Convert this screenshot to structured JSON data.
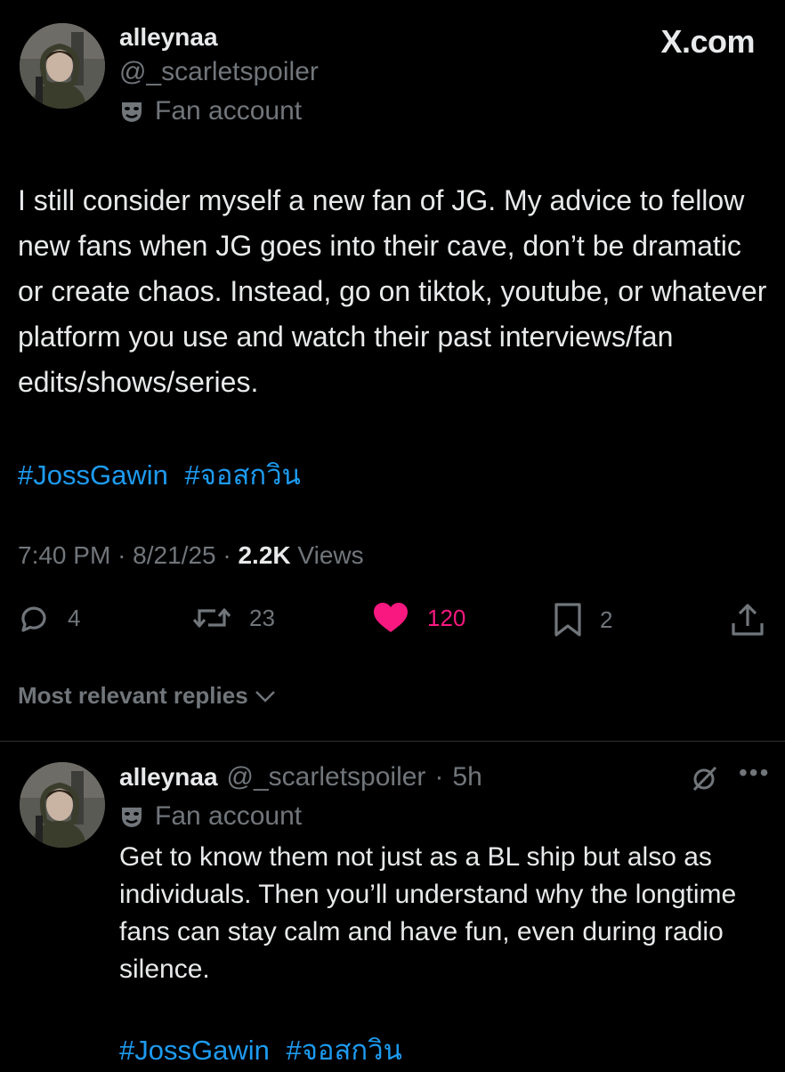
{
  "post": {
    "author": {
      "name": "alleynaa",
      "handle": "@_scarletspoiler",
      "label": "Fan account"
    },
    "site": "X.com",
    "text": "I still consider myself a new fan of JG. My advice to fellow new fans when JG goes into their cave, don’t be dramatic or create chaos. Instead, go on tiktok, youtube, or whatever platform you use and watch their past interviews/fan edits/shows/series.",
    "hashtags": [
      "#JossGawin",
      "#จอสกวิน"
    ],
    "time": "7:40 PM",
    "date": "8/21/25",
    "views_count": "2.2K",
    "views_label": "Views",
    "actions": {
      "replies": "4",
      "reposts": "23",
      "likes": "120",
      "bookmarks": "2"
    }
  },
  "replies_filter": "Most relevant replies",
  "reply": {
    "name": "alleynaa",
    "handle": "@_scarletspoiler",
    "age": "5h",
    "label": "Fan account",
    "text": "Get to know them not just as a BL ship but also as individuals. Then you’ll understand why the longtime fans can stay calm and have fun, even during radio silence.",
    "hashtags": [
      "#JossGawin",
      "#จอสกวิน"
    ]
  },
  "colors": {
    "background": "#000000",
    "text": "#e7e9ea",
    "secondary": "#71767b",
    "link": "#1d9bf0",
    "like": "#f91880",
    "divider": "#2f3336"
  }
}
